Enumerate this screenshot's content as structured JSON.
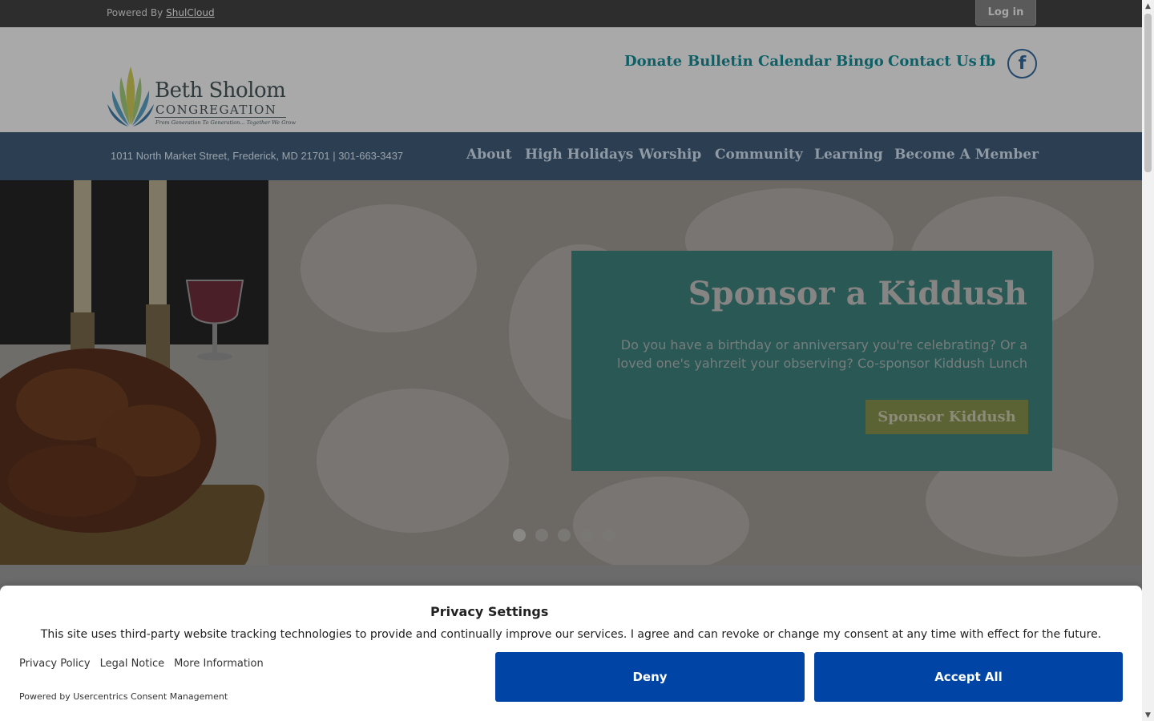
{
  "topbar": {
    "powered_prefix": "Powered By",
    "powered_link": "ShulCloud",
    "login_label": "Log in"
  },
  "logo": {
    "line1": "Beth Sholom",
    "line2": "CONGREGATION",
    "tagline": "From Generation To Generation... Together We Grow"
  },
  "util_nav": {
    "items": [
      "Donate",
      "Bulletin",
      "Calendar",
      "Bingo",
      "Contact Us",
      "fb"
    ],
    "facebook_glyph": "f"
  },
  "navbar": {
    "address": "1011 North Market Street, Frederick, MD 21701 | 301-663-3437",
    "items": [
      "About",
      "High Holidays",
      "Worship",
      "Community",
      "Learning",
      "Become A Member"
    ]
  },
  "hero": {
    "title": "Sponsor a Kiddush",
    "text": "Do you have a birthday or anniversary you're celebrating? Or a loved one's yahrzeit your observing? Co-sponsor Kiddush Lunch",
    "button_label": "Sponsor Kiddush"
  },
  "consent": {
    "title": "Privacy Settings",
    "text": "This site uses third-party website tracking technologies to provide and continually improve our services. I agree and can revoke or change my consent at any time with effect for the future.",
    "links": [
      "Privacy Policy",
      "Legal Notice",
      "More Information"
    ],
    "powered": "Powered by Usercentrics Consent Management",
    "deny_label": "Deny",
    "accept_label": "Accept All"
  },
  "colors": {
    "consent_button": "#0045a5",
    "navbar": "#2c3f52",
    "promo": "#2a5855"
  }
}
